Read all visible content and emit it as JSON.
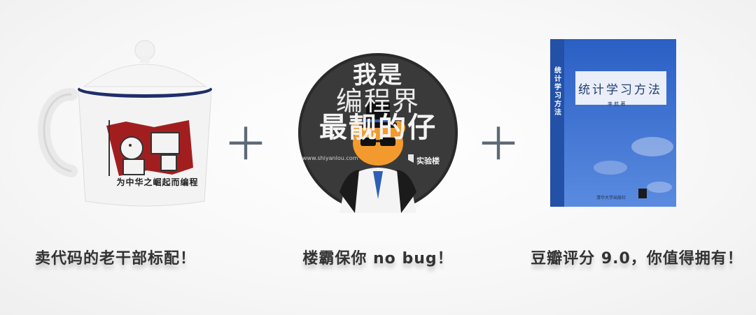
{
  "items": [
    {
      "name": "mug",
      "slogan": "为中华之崛起而编程",
      "caption": "卖代码的老干部标配！"
    },
    {
      "name": "badge",
      "line1": "我是",
      "line2": "编程界",
      "line3": "最靓的仔",
      "url": "www.shiyanlou.com",
      "brand": "实验楼",
      "caption": "楼霸保你 no bug！"
    },
    {
      "name": "book",
      "title": "统计学习方法",
      "spine_title": "统计学习方法",
      "author": "李 航 著",
      "publisher": "清华大学出版社",
      "caption": "豆瓣评分 9.0，你值得拥有！"
    }
  ],
  "separators": [
    "＋",
    "＋"
  ],
  "colors": {
    "caption_text": "#333333",
    "plus": "#5e6a78",
    "badge_bg": "#3a3a3a",
    "book_blue": "#2e63c0"
  }
}
